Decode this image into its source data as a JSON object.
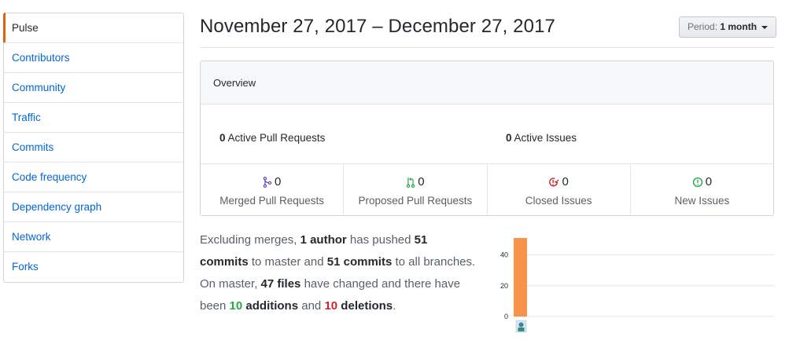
{
  "sidebar": {
    "items": [
      {
        "label": "Pulse",
        "selected": true
      },
      {
        "label": "Contributors"
      },
      {
        "label": "Community"
      },
      {
        "label": "Traffic"
      },
      {
        "label": "Commits"
      },
      {
        "label": "Code frequency"
      },
      {
        "label": "Dependency graph"
      },
      {
        "label": "Network"
      },
      {
        "label": "Forks"
      }
    ]
  },
  "header": {
    "title": "November 27, 2017 – December 27, 2017",
    "period_label": "Period:",
    "period_value": "1 month"
  },
  "overview": {
    "heading": "Overview",
    "active_prs_count": "0",
    "active_prs_label": "Active Pull Requests",
    "active_issues_count": "0",
    "active_issues_label": "Active Issues",
    "stats": [
      {
        "icon": "merged-pr-icon",
        "count": "0",
        "label": "Merged Pull Requests",
        "color": "#6f42c1"
      },
      {
        "icon": "proposed-pr-icon",
        "count": "0",
        "label": "Proposed Pull Requests",
        "color": "#28a745"
      },
      {
        "icon": "closed-issue-icon",
        "count": "0",
        "label": "Closed Issues",
        "color": "#cb2431"
      },
      {
        "icon": "new-issue-icon",
        "count": "0",
        "label": "New Issues",
        "color": "#28a745"
      }
    ]
  },
  "narrative": {
    "p1": "Excluding merges, ",
    "authors": "1 author",
    "p2": " has pushed ",
    "commits_master": "51 commits",
    "p3": " to master and ",
    "commits_all": "51 commits",
    "p4": " to all branches. On master, ",
    "files": "47 files",
    "p5": " have changed and there have been ",
    "additions_num": "10",
    "additions_word": " additions",
    "p6": " and ",
    "deletions_num": "10",
    "deletions_word": " deletions",
    "p7": "."
  },
  "chart_data": {
    "type": "bar",
    "categories": [
      "author-1"
    ],
    "values": [
      51
    ],
    "ylim": [
      0,
      51
    ],
    "yticks": [
      0,
      20,
      40
    ],
    "bar_color": "#f9924a",
    "grid": true,
    "xlabel": "",
    "ylabel": ""
  }
}
